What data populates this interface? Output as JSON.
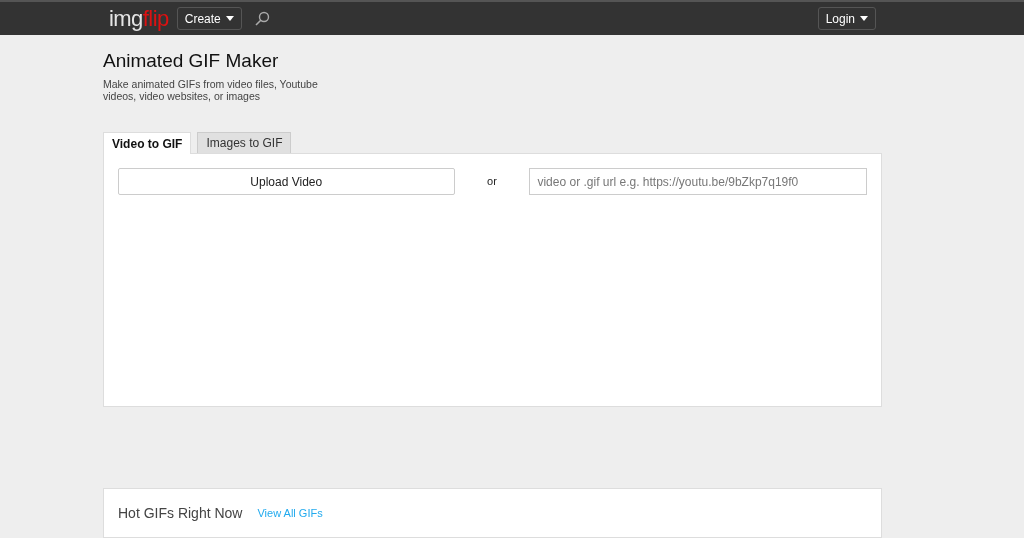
{
  "header": {
    "logo": [
      "img",
      "flip"
    ],
    "create_button": "Create",
    "login_button": "Login"
  },
  "page": {
    "title": "Animated GIF Maker",
    "subtitle": "Make animated GIFs from video files, Youtube videos, video websites, or images"
  },
  "tabs": [
    {
      "label": "Video to GIF",
      "selected": true
    },
    {
      "label": "Images to GIF",
      "selected": false
    }
  ],
  "panel": {
    "upload_button": "Upload Video",
    "separator": "or",
    "url_field": {
      "placeholder": "video or .gif url e.g. https://youtu.be/9bZkp7q19f0"
    }
  },
  "hot_gifs": {
    "title": "Hot GIFs Right Now",
    "link": "View All GIFs"
  }
}
